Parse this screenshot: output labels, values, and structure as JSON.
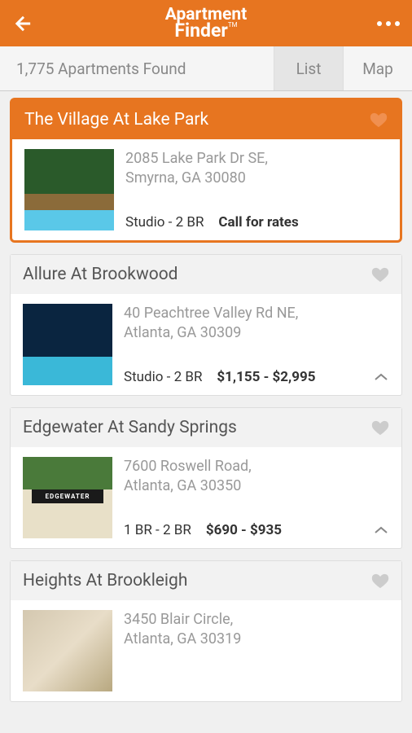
{
  "header": {
    "logo_top": "Apartment",
    "logo_bottom": "Finder",
    "logo_tm": "TM"
  },
  "subbar": {
    "results_count": "1,775 Apartments Found",
    "tab_list": "List",
    "tab_map": "Map"
  },
  "listings": [
    {
      "name": "The Village At Lake Park",
      "address_line1": "2085 Lake Park Dr SE,",
      "address_line2": "Smyrna, GA 30080",
      "bedrooms": "Studio - 2 BR",
      "price": "Call for rates",
      "featured": true,
      "expandable": false
    },
    {
      "name": "Allure At Brookwood",
      "address_line1": "40 Peachtree Valley Rd NE,",
      "address_line2": "Atlanta, GA 30309",
      "bedrooms": "Studio - 2 BR",
      "price": "$1,155 - $2,995",
      "featured": false,
      "expandable": true
    },
    {
      "name": "Edgewater At Sandy Springs",
      "address_line1": "7600 Roswell Road,",
      "address_line2": "Atlanta, GA 30350",
      "bedrooms": "1 BR - 2 BR",
      "price": "$690 - $935",
      "featured": false,
      "expandable": true
    },
    {
      "name": "Heights At Brookleigh",
      "address_line1": "3450 Blair Circle,",
      "address_line2": "Atlanta, GA 30319",
      "bedrooms": "",
      "price": "",
      "featured": false,
      "expandable": false
    }
  ]
}
